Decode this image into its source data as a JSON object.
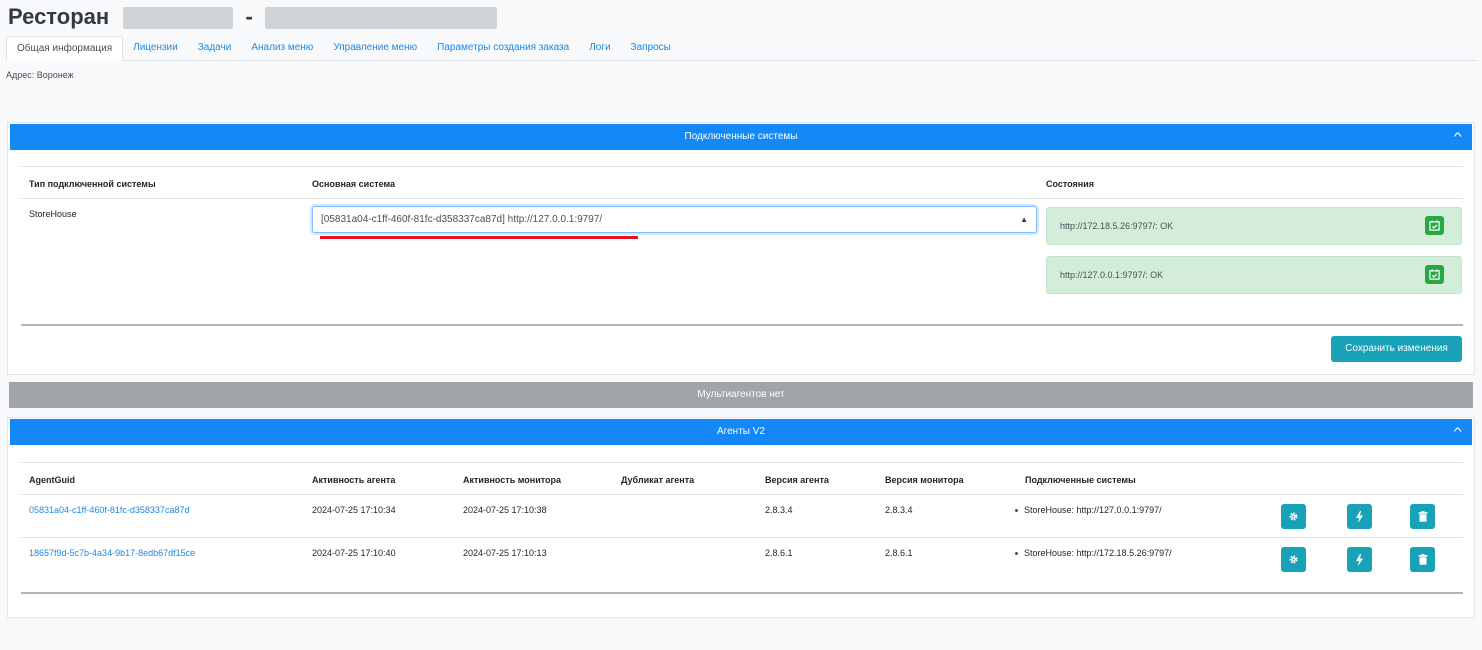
{
  "header": {
    "title": "Ресторан",
    "dash": "-"
  },
  "tabs": [
    {
      "label": "Общая информация",
      "active": true
    },
    {
      "label": "Лицензии"
    },
    {
      "label": "Задачи"
    },
    {
      "label": "Анализ меню"
    },
    {
      "label": "Управление меню"
    },
    {
      "label": "Параметры создания заказа"
    },
    {
      "label": "Логи"
    },
    {
      "label": "Запросы"
    }
  ],
  "address": "Адрес: Воронеж",
  "connected_systems": {
    "header": "Подключенные системы",
    "columns": {
      "type": "Тип подключенной системы",
      "main": "Основная система",
      "states": "Состояния"
    },
    "row": {
      "type": "StoreHouse",
      "selected_main": "[05831a04-c1ff-460f-81fc-d358337ca87d] http://127.0.0.1:9797/"
    },
    "statuses": [
      {
        "text": "http://172.18.5.26:9797/: OK"
      },
      {
        "text": "http://127.0.0.1:9797/: OK"
      }
    ],
    "save_label": "Сохранить изменения"
  },
  "multiagents": {
    "header": "Мультиагентов нет"
  },
  "agents": {
    "header": "Агенты V2",
    "columns": {
      "guid": "AgentGuid",
      "agent_activity": "Активность агента",
      "monitor_activity": "Активность монитора",
      "duplicate": "Дубликат агента",
      "agent_version": "Версия агента",
      "monitor_version": "Версия монитора",
      "systems": "Подключенные системы"
    },
    "rows": [
      {
        "guid": "05831a04-c1ff-460f-81fc-d358337ca87d",
        "agent_activity": "2024-07-25 17:10:34",
        "monitor_activity": "2024-07-25 17:10:38",
        "duplicate": "",
        "agent_version": "2.8.3.4",
        "monitor_version": "2.8.3.4",
        "system": "StoreHouse: http://127.0.0.1:9797/"
      },
      {
        "guid": "18657f9d-5c7b-4a34-9b17-8edb67df15ce",
        "agent_activity": "2024-07-25 17:10:40",
        "monitor_activity": "2024-07-25 17:10:13",
        "duplicate": "",
        "agent_version": "2.8.6.1",
        "monitor_version": "2.8.6.1",
        "system": "StoreHouse: http://172.18.5.26:9797/"
      }
    ]
  },
  "icons": {
    "collapse": "chevron-up-icon",
    "status_action": "calendar-check-icon",
    "settings": "gear-icon",
    "restart": "bolt-icon",
    "delete": "trash-icon"
  },
  "colors": {
    "primary": "#1388f6",
    "info": "#17a2b8",
    "success": "#28a745",
    "muted_header": "#a1a5a9",
    "annotation": "#e3121d"
  }
}
